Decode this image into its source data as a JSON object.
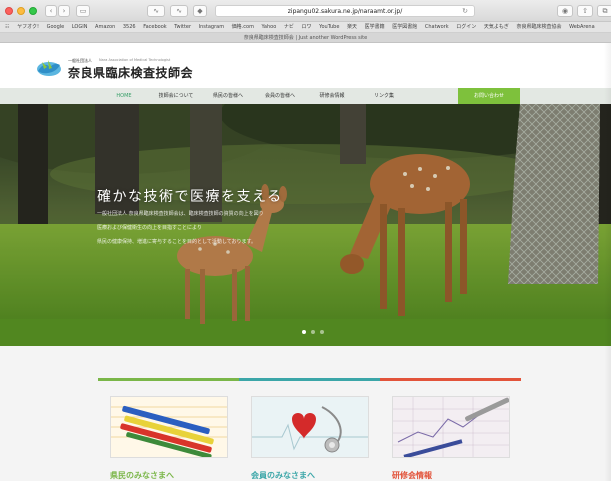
{
  "browser": {
    "url": "zipangu02.sakura.ne.jp/naraamt.or.jp/",
    "tab_title": "奈良県臨床検査技師会 | Just another WordPress site",
    "bookmarks": [
      "ヤフオク!",
      "Google",
      "LOGIN",
      "Amazon",
      "3526",
      "Facebook",
      "Twitter",
      "Instagram",
      "価格.com",
      "Yahoo",
      "ナビ",
      "ロワ",
      "YouTube",
      "楽天",
      "医学書籍",
      "医学図書館",
      "Chatwork",
      "ログイン",
      "天気よもぎ",
      "奈良県臨床検査協会",
      "WebArena"
    ]
  },
  "site": {
    "logo_small": "一般社団法人",
    "logo_en": "Nara Association of Medical Technologist",
    "logo_main": "奈良県臨床検査技師会"
  },
  "nav": {
    "items": [
      "HOME",
      "技師会について",
      "県民の皆様へ",
      "会員の皆様へ",
      "研修会情報",
      "リンク集",
      "お問い合わせ"
    ]
  },
  "hero": {
    "title": "確かな技術で医療を支える",
    "lines": [
      "一般社団法人 奈良県臨床検査技師会は、臨床検査技師の資質の向上を図り",
      "医療および保健衛生の向上を目指すことにより",
      "県民の健康保持、増進に寄与することを目的として活動しております。"
    ]
  },
  "cards": [
    {
      "title": "県民のみなさまへ",
      "color": "#7ab648"
    },
    {
      "title": "会員のみなさまへ",
      "color": "#3ba6a8"
    },
    {
      "title": "研修会情報",
      "color": "#e2533a"
    }
  ]
}
